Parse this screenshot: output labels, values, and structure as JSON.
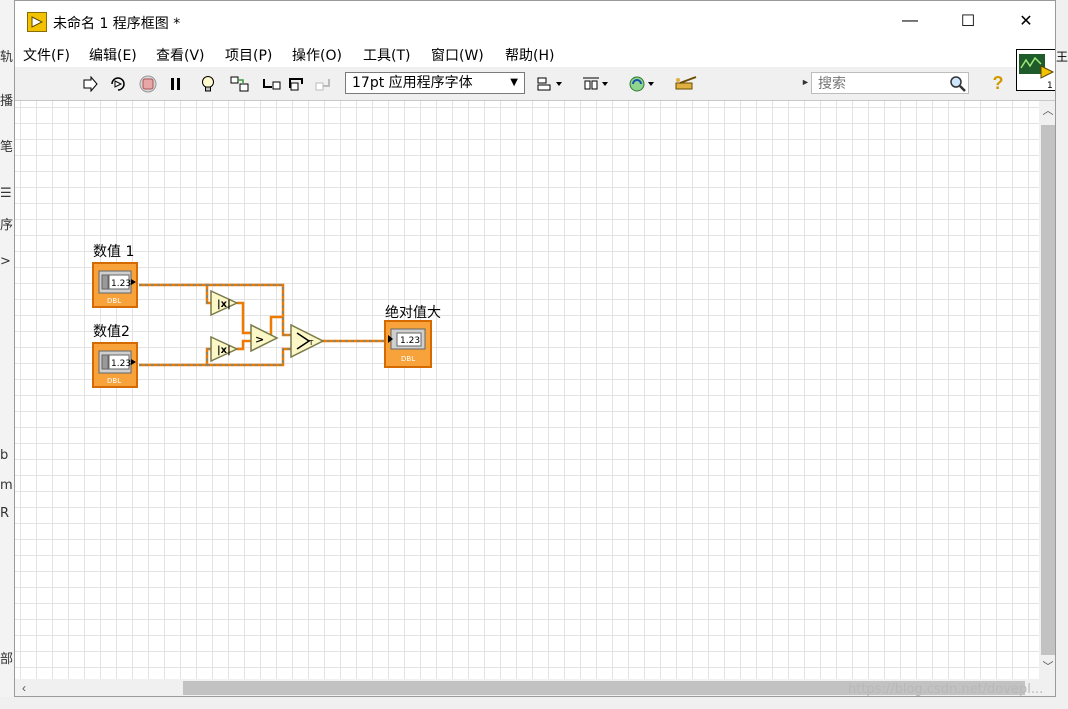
{
  "window": {
    "title": "未命名 1 程序框图 *",
    "minimize": "—",
    "maximize": "☐",
    "close": "✕"
  },
  "menu": [
    {
      "label": "文件(F)"
    },
    {
      "label": "编辑(E)"
    },
    {
      "label": "查看(V)"
    },
    {
      "label": "项目(P)"
    },
    {
      "label": "操作(O)"
    },
    {
      "label": "工具(T)"
    },
    {
      "label": "窗口(W)"
    },
    {
      "label": "帮助(H)"
    }
  ],
  "toolbar": {
    "font": "17pt 应用程序字体",
    "search_placeholder": "搜索",
    "help": "?"
  },
  "diagram": {
    "control1_label": "数值 1",
    "control2_label": "数值2",
    "indicator_label": "绝对值大",
    "numeric_text": "1.23",
    "type_text": "DBL",
    "wire_color": "#f07a00"
  },
  "background": {
    "left_fragments": [
      "轨",
      "播",
      "笔",
      "☰",
      "序",
      ">",
      "b",
      "m",
      "R",
      "部"
    ],
    "right_fragment": "王"
  },
  "watermark": "https://blog.csdn.net/dovepl..."
}
